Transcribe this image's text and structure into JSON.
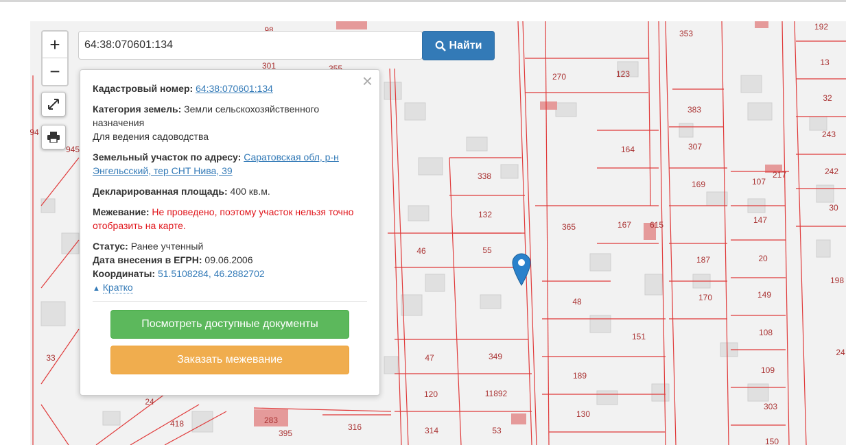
{
  "search": {
    "value": "64:38:070601:134",
    "button": "Найти",
    "icon": "search-icon"
  },
  "controls": {
    "zoom_in": "+",
    "zoom_out": "−",
    "fullscreen_icon": "expand-icon",
    "print_icon": "print-icon"
  },
  "popup": {
    "cad_label": "Кадастровый номер:",
    "cad_value": "64:38:070601:134",
    "cat_label": "Категория земель:",
    "cat_value": "Земли сельскохозяйственного назначения",
    "use": "Для ведения садоводства",
    "addr_label": "Земельный участок по адресу:",
    "addr_value": "Саратовская обл, р-н Энгельсский, тер СНТ Нива, 39",
    "area_label": "Декларированная площадь:",
    "area_value": "400 кв.м.",
    "survey_label": "Межевание:",
    "survey_value": "Не проведено, поэтому участок нельзя точно отобразить на карте.",
    "status_label": "Статус:",
    "status_value": "Ранее учтенный",
    "date_label": "Дата внесения в ЕГРН:",
    "date_value": "09.06.2006",
    "coords_label": "Координаты:",
    "coords_value": "51.5108284, 46.2882702",
    "collapse": "Кратко",
    "docs_button": "Посмотреть доступные документы",
    "order_button": "Заказать межевание",
    "close": "×"
  },
  "colors": {
    "parcel_line": "#e03a3a",
    "building": "#e0e0e0",
    "primary": "#337ab7",
    "success": "#5cb85c",
    "warning": "#f0ad4e",
    "marker": "#2a81cb"
  },
  "parcels": [
    "353",
    "192",
    "270",
    "123",
    "13",
    "383",
    "32",
    "164",
    "307",
    "243",
    "338",
    "169",
    "107",
    "217",
    "242",
    "132",
    "365",
    "167",
    "615",
    "147",
    "30",
    "46",
    "55",
    "187",
    "20",
    "198",
    "48",
    "170",
    "149",
    "151",
    "108",
    "47",
    "349",
    "189",
    "109",
    "24",
    "120",
    "11892",
    "130",
    "303",
    "283",
    "395",
    "316",
    "314",
    "53",
    "150",
    "98",
    "301",
    "355",
    "945",
    "94",
    "33",
    "24",
    "418"
  ]
}
